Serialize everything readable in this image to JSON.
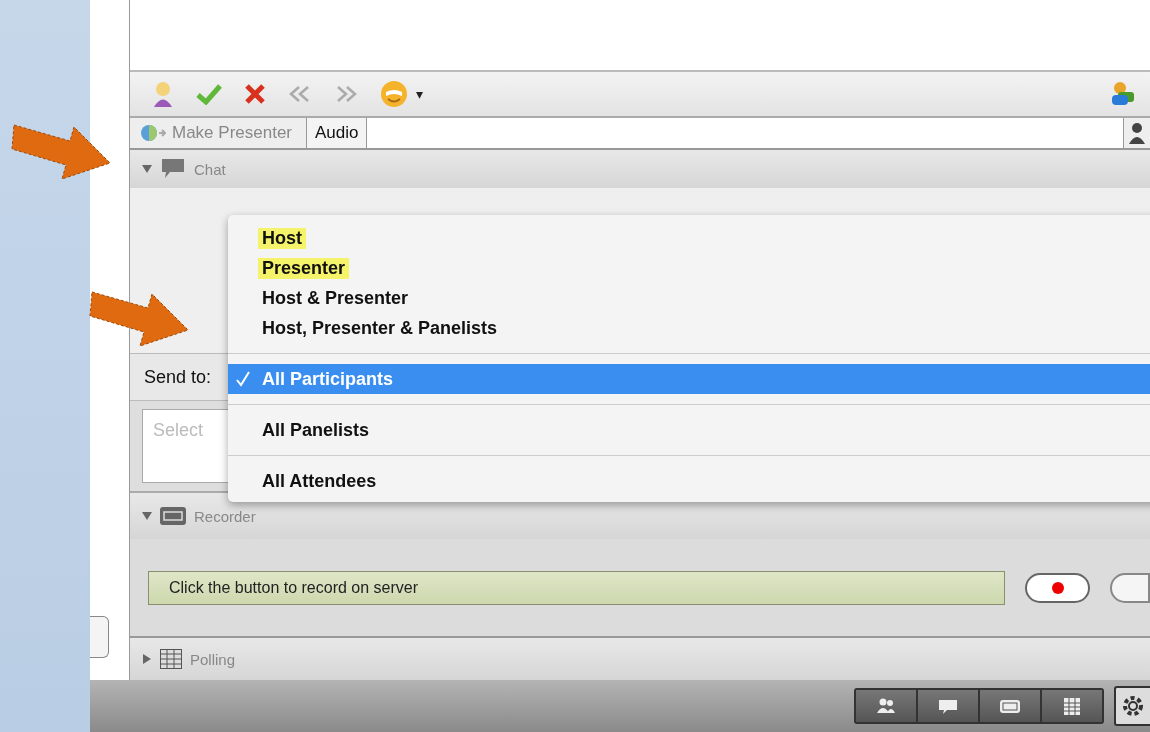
{
  "toolbar": {
    "dropdown_caret": "▾"
  },
  "presenter_bar": {
    "make_presenter": "Make Presenter",
    "make_presenter_disabled": true,
    "tab": "Audio"
  },
  "panels": [
    {
      "kind": "chat",
      "title": "Chat",
      "expanded": true
    },
    {
      "kind": "recorder",
      "title": "Recorder",
      "expanded": true
    },
    {
      "kind": "polling",
      "title": "Polling",
      "expanded": false
    }
  ],
  "chat": {
    "send_to_label": "Send to:",
    "message_placeholder": "Select"
  },
  "send_to_menu": {
    "sections": [
      {
        "items": [
          {
            "label": "Host",
            "selected": false,
            "highlighted": true
          },
          {
            "label": "Presenter",
            "selected": false,
            "highlighted": true
          },
          {
            "label": "Host & Presenter",
            "selected": false,
            "highlighted": false
          },
          {
            "label": "Host, Presenter & Panelists",
            "selected": false,
            "highlighted": false
          }
        ]
      },
      {
        "items": [
          {
            "label": "All Participants",
            "selected": true,
            "highlighted": false
          }
        ]
      },
      {
        "items": [
          {
            "label": "All Panelists",
            "selected": false,
            "highlighted": false
          }
        ]
      },
      {
        "items": [
          {
            "label": "All Attendees",
            "selected": false,
            "highlighted": false
          }
        ]
      }
    ]
  },
  "recorder": {
    "status": "Click the button to record on server"
  },
  "bottom_bar": [
    {
      "kind": "participants",
      "selected": false
    },
    {
      "kind": "chat",
      "selected": false
    },
    {
      "kind": "recorder",
      "selected": false
    },
    {
      "kind": "polling",
      "selected": false
    }
  ]
}
